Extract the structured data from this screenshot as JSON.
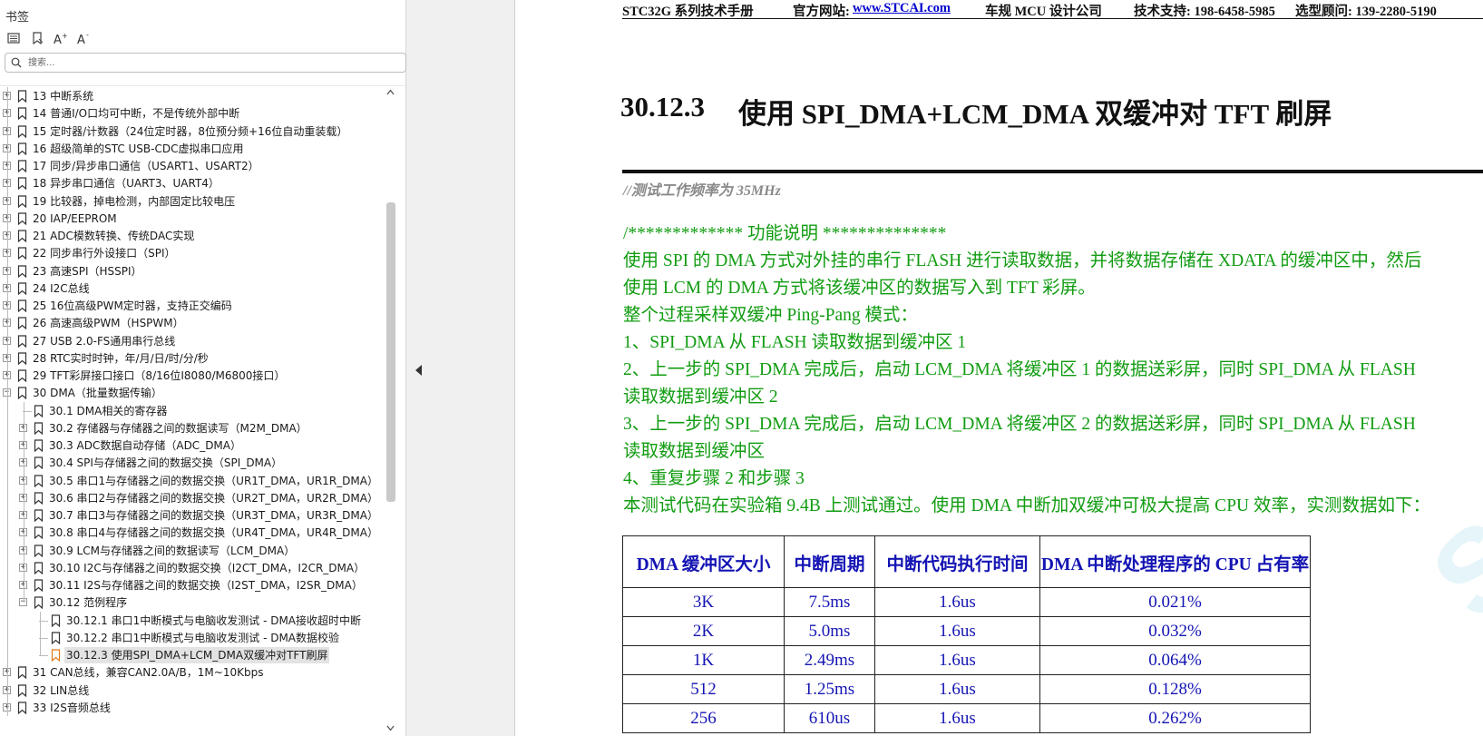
{
  "sidebar": {
    "title": "书签",
    "search_placeholder": "搜索...",
    "items": [
      {
        "label": "13  中断系统",
        "level": 0,
        "expander": "+"
      },
      {
        "label": "14  普通I/O口均可中断，不是传统外部中断",
        "level": 0,
        "expander": "+"
      },
      {
        "label": "15  定时器/计数器（24位定时器，8位预分频+16位自动重装载）",
        "level": 0,
        "expander": "+"
      },
      {
        "label": "16  超级简单的STC USB-CDC虚拟串口应用",
        "level": 0,
        "expander": "+"
      },
      {
        "label": "17  同步/异步串口通信（USART1、USART2）",
        "level": 0,
        "expander": "+"
      },
      {
        "label": "18  异步串口通信（UART3、UART4）",
        "level": 0,
        "expander": "+"
      },
      {
        "label": "19  比较器，掉电检测，内部固定比较电压",
        "level": 0,
        "expander": "+"
      },
      {
        "label": "20  IAP/EEPROM",
        "level": 0,
        "expander": "+"
      },
      {
        "label": "21  ADC模数转换、传统DAC实现",
        "level": 0,
        "expander": "+"
      },
      {
        "label": "22  同步串行外设接口（SPI）",
        "level": 0,
        "expander": "+"
      },
      {
        "label": "23  高速SPI（HSSPI）",
        "level": 0,
        "expander": "+"
      },
      {
        "label": "24  I2C总线",
        "level": 0,
        "expander": "+"
      },
      {
        "label": "25  16位高级PWM定时器，支持正交编码",
        "level": 0,
        "expander": "+"
      },
      {
        "label": "26  高速高级PWM（HSPWM）",
        "level": 0,
        "expander": "+"
      },
      {
        "label": "27  USB 2.0-FS通用串行总线",
        "level": 0,
        "expander": "+"
      },
      {
        "label": "28  RTC实时时钟，年/月/日/时/分/秒",
        "level": 0,
        "expander": "+"
      },
      {
        "label": "29  TFT彩屏接口接口（8/16位I8080/M6800接口）",
        "level": 0,
        "expander": "+"
      },
      {
        "label": "30  DMA（批量数据传输）",
        "level": 0,
        "expander": "-"
      },
      {
        "label": "30.1  DMA相关的寄存器",
        "level": 1,
        "expander": ""
      },
      {
        "label": "30.2  存储器与存储器之间的数据读写（M2M_DMA）",
        "level": 1,
        "expander": "+"
      },
      {
        "label": "30.3  ADC数据自动存储（ADC_DMA）",
        "level": 1,
        "expander": "+"
      },
      {
        "label": "30.4  SPI与存储器之间的数据交换（SPI_DMA）",
        "level": 1,
        "expander": "+"
      },
      {
        "label": "30.5  串口1与存储器之间的数据交换（UR1T_DMA，UR1R_DMA）",
        "level": 1,
        "expander": "+"
      },
      {
        "label": "30.6  串口2与存储器之间的数据交换（UR2T_DMA，UR2R_DMA）",
        "level": 1,
        "expander": "+"
      },
      {
        "label": "30.7  串口3与存储器之间的数据交换（UR3T_DMA，UR3R_DMA）",
        "level": 1,
        "expander": "+"
      },
      {
        "label": "30.8  串口4与存储器之间的数据交换（UR4T_DMA，UR4R_DMA）",
        "level": 1,
        "expander": "+"
      },
      {
        "label": "30.9  LCM与存储器之间的数据读写（LCM_DMA）",
        "level": 1,
        "expander": "+"
      },
      {
        "label": "30.10  I2C与存储器之间的数据交换（I2CT_DMA，I2CR_DMA）",
        "level": 1,
        "expander": "+"
      },
      {
        "label": "30.11  I2S与存储器之间的数据交换（I2ST_DMA，I2SR_DMA）",
        "level": 1,
        "expander": "+"
      },
      {
        "label": "30.12  范例程序",
        "level": 1,
        "expander": "-"
      },
      {
        "label": "30.12.1 串口1中断模式与电脑收发测试 - DMA接收超时中断",
        "level": 2,
        "expander": ""
      },
      {
        "label": "30.12.2 串口1中断模式与电脑收发测试 - DMA数据校验",
        "level": 2,
        "expander": ""
      },
      {
        "label": "30.12.3 使用SPI_DMA+LCM_DMA双缓冲对TFT刷屏",
        "level": 2,
        "expander": "",
        "selected": true
      },
      {
        "label": "31  CAN总线，兼容CAN2.0A/B，1M~10Kbps",
        "level": 0,
        "expander": "+"
      },
      {
        "label": "32  LIN总线",
        "level": 0,
        "expander": "+"
      },
      {
        "label": "33  I2S音频总线",
        "level": 0,
        "expander": "+"
      }
    ]
  },
  "document": {
    "header": {
      "manual": "STC32G 系列技术手册",
      "site_label": "官方网站:",
      "site_link": "www.STCAI.com",
      "company": "车规 MCU 设计公司",
      "support": "技术支持: 198-6458-5985",
      "advisor": "选型顾问: 139-2280-5190"
    },
    "section_number": "30.12.3",
    "section_title": "使用 SPI_DMA+LCM_DMA 双缓冲对 TFT 刷屏",
    "code_comment": "//测试工作频率为 35MHz",
    "lines": [
      "/*************    功能说明        **************",
      "使用 SPI 的 DMA 方式对外挂的串行 FLASH 进行读取数据，并将数据存储在 XDATA 的缓冲区中，然后",
      "使用 LCM 的 DMA 方式将该缓冲区的数据写入到 TFT 彩屏。",
      "整个过程采样双缓冲 Ping-Pang 模式：",
      "1、SPI_DMA 从 FLASH 读取数据到缓冲区 1",
      "2、上一步的 SPI_DMA 完成后，启动 LCM_DMA 将缓冲区 1 的数据送彩屏，同时 SPI_DMA 从 FLASH",
      "读取数据到缓冲区 2",
      "3、上一步的 SPI_DMA 完成后，启动 LCM_DMA 将缓冲区 2 的数据送彩屏，同时 SPI_DMA 从 FLASH",
      "读取数据到缓冲区",
      "4、重复步骤 2 和步骤 3",
      "本测试代码在实验箱 9.4B 上测试通过。使用 DMA 中断加双缓冲可极大提高 CPU 效率，实测数据如下："
    ],
    "table": {
      "headers": [
        "DMA 缓冲区大小",
        "中断周期",
        "中断代码执行时间",
        "DMA 中断处理程序的 CPU 占有率"
      ],
      "rows": [
        [
          "3K",
          "7.5ms",
          "1.6us",
          "0.021%"
        ],
        [
          "2K",
          "5.0ms",
          "1.6us",
          "0.032%"
        ],
        [
          "1K",
          "2.49ms",
          "1.6us",
          "0.064%"
        ],
        [
          "512",
          "1.25ms",
          "1.6us",
          "0.128%"
        ],
        [
          "256",
          "610us",
          "1.6us",
          "0.262%"
        ]
      ]
    },
    "watermark": "STC MCU"
  }
}
